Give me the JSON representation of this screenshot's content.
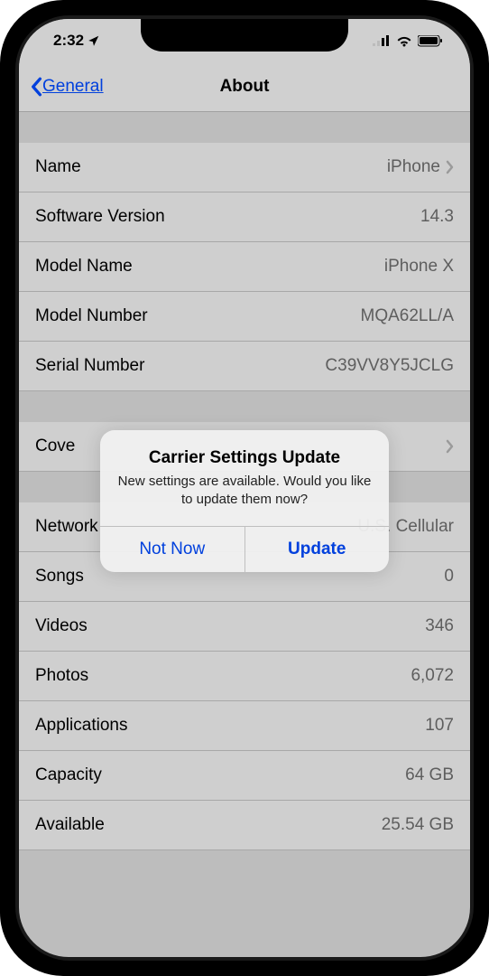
{
  "status": {
    "time": "2:32",
    "signal_bars": ".ıl",
    "wifi": "wifi-icon",
    "battery": "battery-icon"
  },
  "nav": {
    "back_label": "General",
    "title": "About"
  },
  "sections": [
    {
      "rows": [
        {
          "label": "Name",
          "value": "iPhone",
          "disclosure": true
        },
        {
          "label": "Software Version",
          "value": "14.3",
          "disclosure": false
        },
        {
          "label": "Model Name",
          "value": "iPhone X",
          "disclosure": false
        },
        {
          "label": "Model Number",
          "value": "MQA62LL/A",
          "disclosure": false
        },
        {
          "label": "Serial Number",
          "value": "C39VV8Y5JCLG",
          "disclosure": false
        }
      ]
    },
    {
      "rows": [
        {
          "label": "Cove",
          "value": "",
          "disclosure": true
        }
      ]
    },
    {
      "rows": [
        {
          "label": "Network",
          "value": "U.S. Cellular",
          "disclosure": false
        },
        {
          "label": "Songs",
          "value": "0",
          "disclosure": false
        },
        {
          "label": "Videos",
          "value": "346",
          "disclosure": false
        },
        {
          "label": "Photos",
          "value": "6,072",
          "disclosure": false
        },
        {
          "label": "Applications",
          "value": "107",
          "disclosure": false
        },
        {
          "label": "Capacity",
          "value": "64 GB",
          "disclosure": false
        },
        {
          "label": "Available",
          "value": "25.54 GB",
          "disclosure": false
        }
      ]
    }
  ],
  "alert": {
    "title": "Carrier Settings Update",
    "message": "New settings are available. Would you like to update them now?",
    "buttons": {
      "cancel": "Not Now",
      "confirm": "Update"
    }
  }
}
